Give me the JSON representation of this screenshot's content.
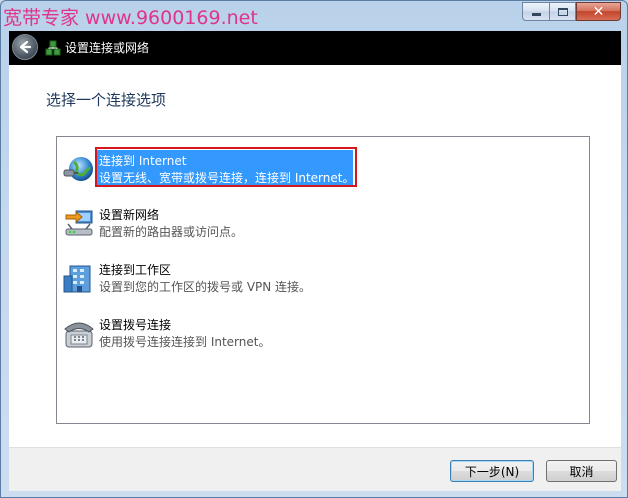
{
  "watermark": "宽带专家 www.9600169.net",
  "caption": {
    "minimize": "—",
    "maximize": "□",
    "close": "✕"
  },
  "nav": {
    "title": "设置连接或网络"
  },
  "heading": "选择一个连接选项",
  "options": [
    {
      "title": "连接到 Internet",
      "desc": "设置无线、宽带或拨号连接，连接到 Internet。",
      "icon": "globe-icon",
      "selected": true
    },
    {
      "title": "设置新网络",
      "desc": "配置新的路由器或访问点。",
      "icon": "network-router-icon",
      "selected": false
    },
    {
      "title": "连接到工作区",
      "desc": "设置到您的工作区的拨号或 VPN 连接。",
      "icon": "workplace-building-icon",
      "selected": false
    },
    {
      "title": "设置拨号连接",
      "desc": "使用拨号连接连接到 Internet。",
      "icon": "telephone-icon",
      "selected": false
    }
  ],
  "buttons": {
    "next": "下一步(N)",
    "cancel": "取消"
  },
  "colors": {
    "selection": "#3399ff",
    "highlight_box": "#d4161f",
    "heading": "#1e395b",
    "watermark": "#e0348a"
  }
}
